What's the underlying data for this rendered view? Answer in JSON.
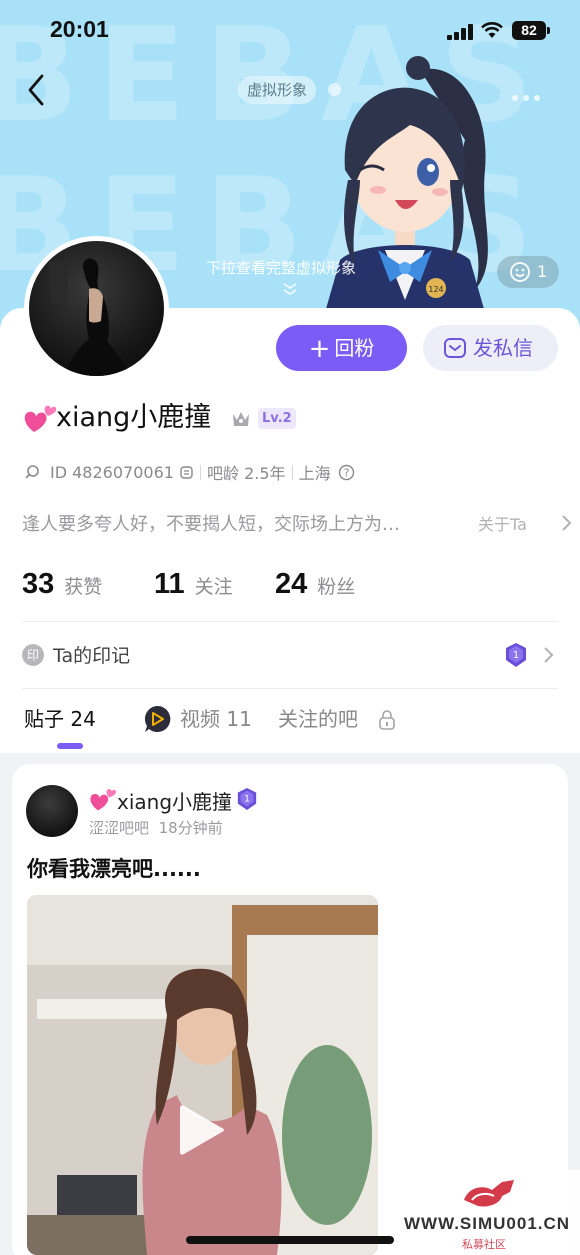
{
  "status_bar": {
    "time": "20:01",
    "battery": "82"
  },
  "hero": {
    "pattern_text": "BEBAS",
    "avatar_pill": "虚拟形象",
    "pull_hint": "下拉查看完整虚拟形象",
    "like_count": "1",
    "figure_badge": "124"
  },
  "actions": {
    "follow": "回粉",
    "message": "发私信"
  },
  "profile": {
    "username": "xiang小鹿撞",
    "level": "Lv.2",
    "id": "ID 4826070061",
    "age": "吧龄 2.5年",
    "location": "上海",
    "bio": "逢人要多夸人好，不要揭人短，交际场上方为…",
    "about": "关于Ta"
  },
  "stats": [
    {
      "num": "33",
      "label": "获赞"
    },
    {
      "num": "11",
      "label": "关注"
    },
    {
      "num": "24",
      "label": "粉丝"
    }
  ],
  "marks": {
    "icon_text": "印",
    "label": "Ta的印记",
    "medal_num": "1"
  },
  "tabs": [
    {
      "label": "贴子 24"
    },
    {
      "label": "视频 11"
    },
    {
      "label": "关注的吧"
    }
  ],
  "post": {
    "username": "xiang小鹿撞",
    "forum": "涩涩吧吧",
    "time": "18分钟前",
    "title": "你看我漂亮吧......"
  },
  "watermark": {
    "url": "WWW.SIMU001.CN",
    "sub": "私募社区"
  },
  "colors": {
    "accent": "#7b5cf6",
    "hero_bg": "#a9e2f8",
    "level_badge": "#ede7fb"
  }
}
